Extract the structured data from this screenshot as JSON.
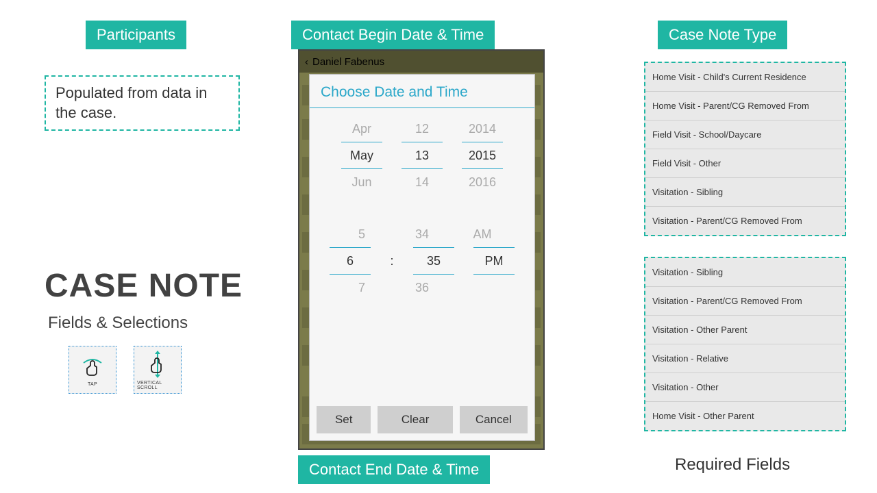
{
  "labels": {
    "participants": "Participants",
    "begin": "Contact Begin Date & Time",
    "end": "Contact End Date & Time",
    "type": "Case Note Type",
    "required": "Required Fields"
  },
  "participants_note": "Populated from data in the case.",
  "heading": "CASE NOTE",
  "subheading": "Fields & Selections",
  "icons": {
    "tap": "TAP",
    "scroll": "VERTICAL SCROLL"
  },
  "phone": {
    "header_name": "Daniel Fabenus",
    "dialog_title": "Choose Date and Time",
    "date": {
      "month": {
        "prev": "Apr",
        "cur": "May",
        "next": "Jun"
      },
      "day": {
        "prev": "12",
        "cur": "13",
        "next": "14"
      },
      "year": {
        "prev": "2014",
        "cur": "2015",
        "next": "2016"
      }
    },
    "time": {
      "hour": {
        "prev": "5",
        "cur": "6",
        "next": "7"
      },
      "minute": {
        "prev": "34",
        "cur": "35",
        "next": "36"
      },
      "ampm": {
        "prev": "AM",
        "cur": "PM",
        "next": ""
      }
    },
    "buttons": {
      "set": "Set",
      "clear": "Clear",
      "cancel": "Cancel"
    }
  },
  "type_list_top": [
    "Home Visit - Child's Current Residence",
    "Home Visit - Parent/CG Removed From",
    "Field Visit - School/Daycare",
    "Field Visit - Other",
    "Visitation - Sibling",
    "Visitation - Parent/CG Removed From"
  ],
  "type_list_bottom": [
    "Visitation - Sibling",
    "Visitation - Parent/CG Removed From",
    "Visitation - Other Parent",
    "Visitation - Relative",
    "Visitation - Other",
    "Home Visit - Other Parent"
  ]
}
